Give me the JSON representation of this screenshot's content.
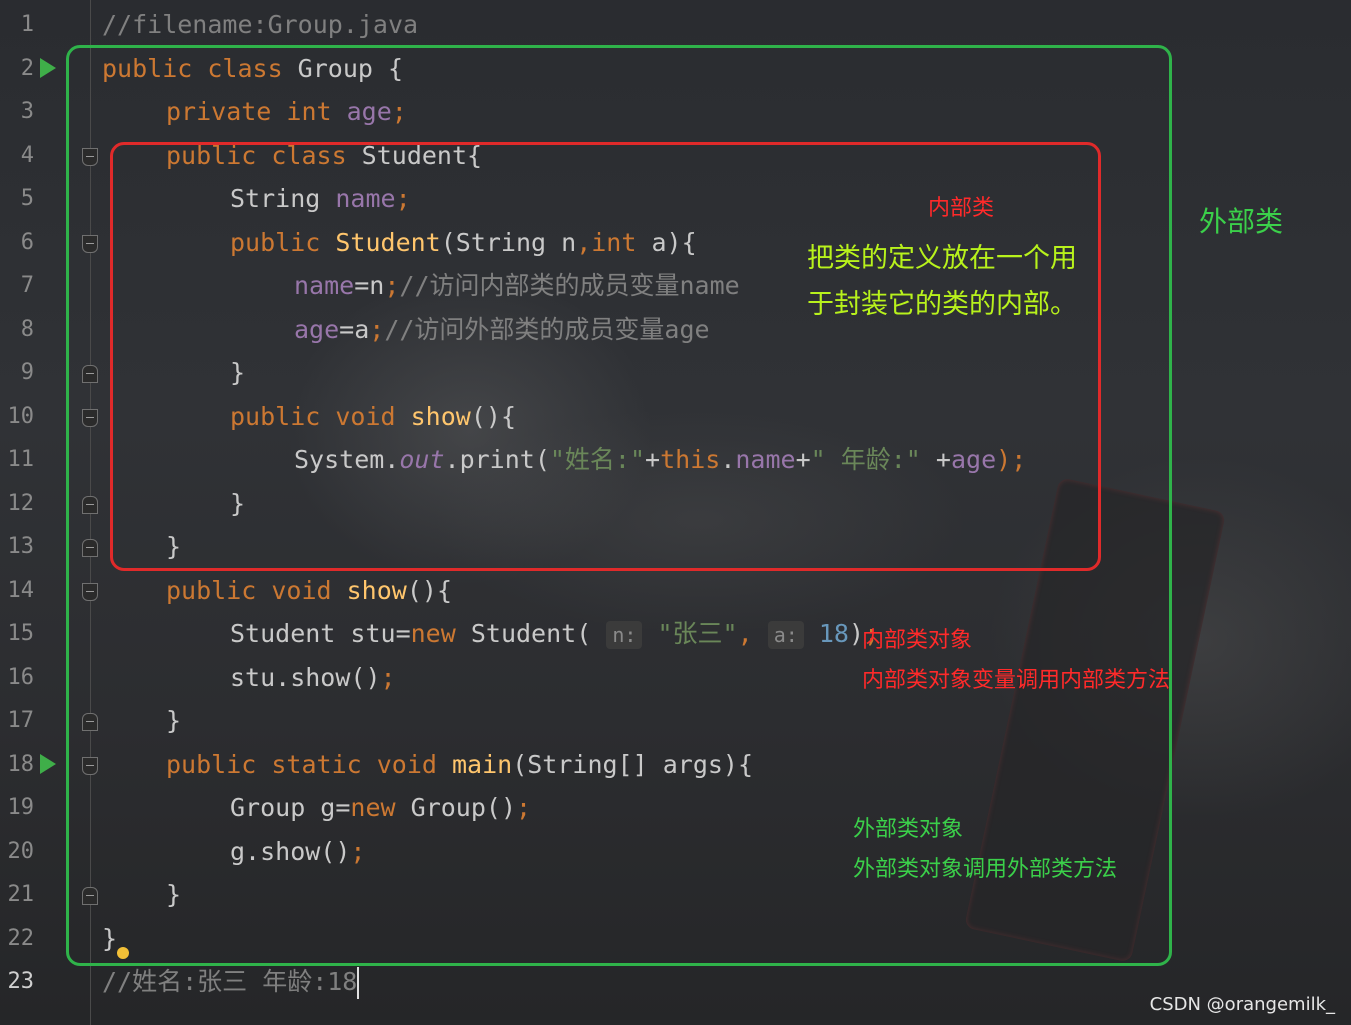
{
  "editor": {
    "line_numbers": [
      "1",
      "2",
      "3",
      "4",
      "5",
      "6",
      "7",
      "8",
      "9",
      "10",
      "11",
      "12",
      "13",
      "14",
      "15",
      "16",
      "17",
      "18",
      "19",
      "20",
      "21",
      "22",
      "23"
    ],
    "lines": {
      "l1": [
        "//filename:Group.java"
      ],
      "l2": [
        "public class ",
        "Group {"
      ],
      "l3": [
        "private int ",
        "age",
        ";"
      ],
      "l4": [
        "public class ",
        "Student{"
      ],
      "l5": [
        "String ",
        "name",
        ";"
      ],
      "l6": [
        "public ",
        "Student",
        "(String n",
        ",",
        "int ",
        "a){"
      ],
      "l7": [
        "name",
        "=n",
        ";",
        "//访问内部类的成员变量name"
      ],
      "l8": [
        "age",
        "=a",
        ";",
        "//访问外部类的成员变量age"
      ],
      "l9": [
        "}"
      ],
      "l10": [
        "public void ",
        "show",
        "(){"
      ],
      "l11": [
        "System.",
        "out",
        ".print(",
        "\"姓名:\"",
        "+",
        "this",
        ".",
        "name",
        "+",
        "\" 年龄:\"",
        " +",
        "age",
        ");"
      ],
      "l12": [
        "}"
      ],
      "l13": [
        "}"
      ],
      "l14": [
        "public void ",
        "show",
        "(){"
      ],
      "l15": [
        "Student stu=",
        "new ",
        "Student( ",
        "n:",
        " ",
        "\"张三\"",
        ", ",
        "a:",
        " ",
        "18",
        ")",
        ";"
      ],
      "l16": [
        "stu.show()",
        ";"
      ],
      "l17": [
        "}"
      ],
      "l18": [
        "public static void ",
        "main",
        "(String[] args){"
      ],
      "l19": [
        "Group g=",
        "new ",
        "Group()",
        ";"
      ],
      "l20": [
        "g.show()",
        ";"
      ],
      "l21": [
        "}"
      ],
      "l22": [
        "}"
      ],
      "l23": [
        "//姓名:张三 年龄:18"
      ]
    }
  },
  "annotations": {
    "inner_class": "内部类",
    "outer_class": "外部类",
    "definition_line1": "把类的定义放在一个用",
    "definition_line2": "于封装它的类的内部。",
    "inner_object": "内部类对象",
    "inner_object_call": "内部类对象变量调用内部类方法",
    "outer_object": "外部类对象",
    "outer_object_call": "外部类对象调用外部类方法"
  },
  "watermark": "CSDN @orangemilk_",
  "colors": {
    "outer_box": "#2fb34a",
    "inner_box": "#e02a2a",
    "keyword": "#cc7832",
    "function": "#ffc66d",
    "field": "#9876aa",
    "string": "#6a8759",
    "number": "#6897bb",
    "comment": "#808080"
  },
  "icons": [
    "run-icon",
    "fold-icon",
    "lightbulb-icon"
  ]
}
